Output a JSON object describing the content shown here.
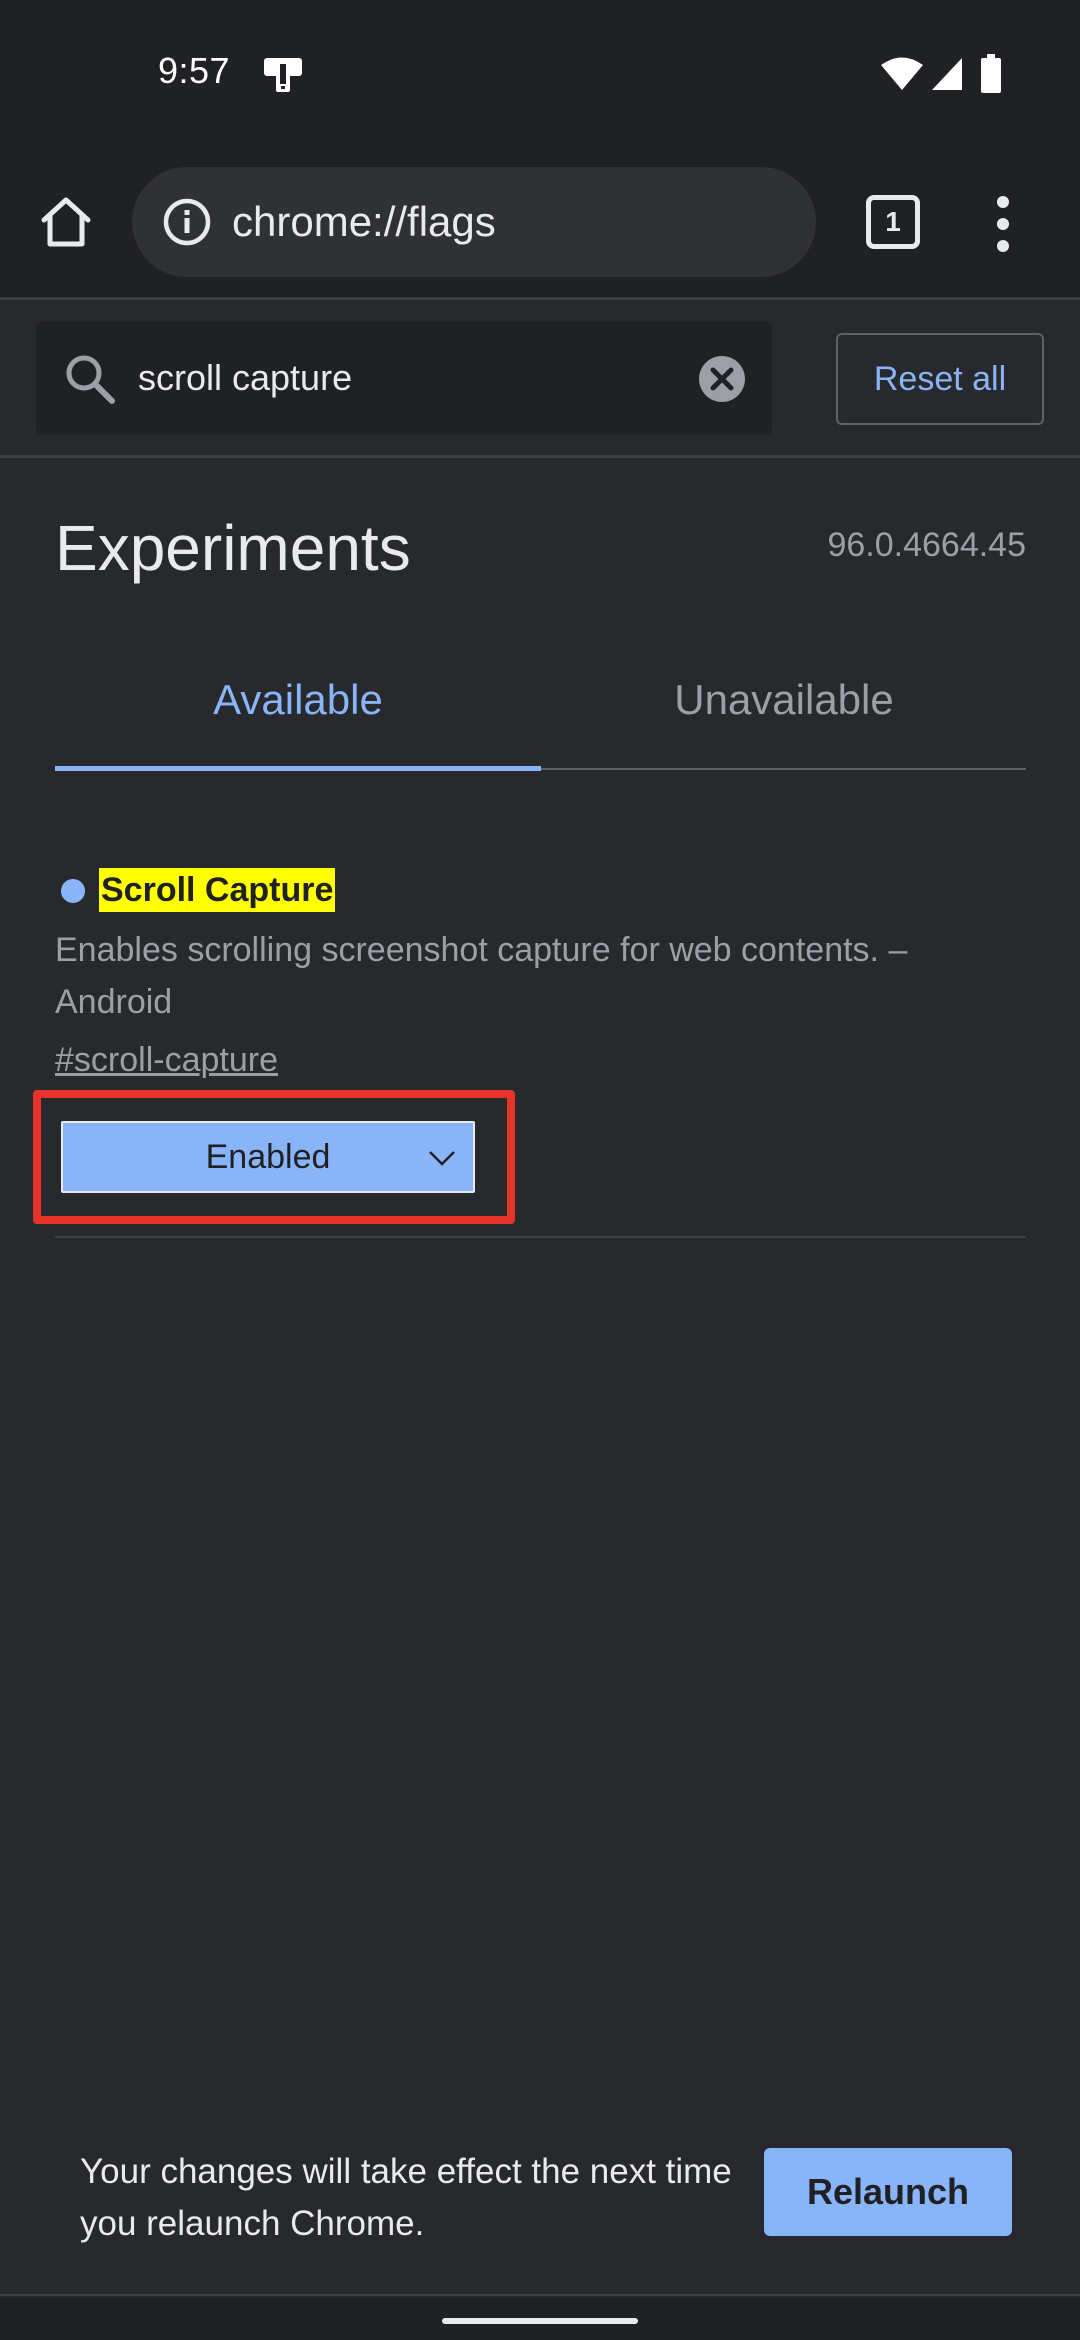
{
  "status_bar": {
    "time": "9:57",
    "icons": [
      "notification-icon",
      "wifi-icon",
      "signal-icon",
      "battery-icon"
    ]
  },
  "toolbar": {
    "url": "chrome://flags",
    "tab_count": "1",
    "icons": [
      "home-icon",
      "info-icon",
      "menu-icon"
    ]
  },
  "search": {
    "value": "scroll capture",
    "reset_label": "Reset all"
  },
  "page": {
    "title": "Experiments",
    "version": "96.0.4664.45",
    "tabs": [
      {
        "label": "Available",
        "active": true
      },
      {
        "label": "Unavailable",
        "active": false
      }
    ]
  },
  "experiment": {
    "name": "Scroll Capture",
    "description": "Enables scrolling screenshot capture for web contents. – Android",
    "link": "#scroll-capture",
    "selected": "Enabled"
  },
  "relaunch": {
    "message": "Your changes will take effect the next time you relaunch Chrome.",
    "button_label": "Relaunch"
  },
  "colors": {
    "accent": "#8ab4f8",
    "highlight": "#ffff00",
    "annotation": "#e8332b",
    "background": "#28292d",
    "toolbar": "#202124"
  }
}
